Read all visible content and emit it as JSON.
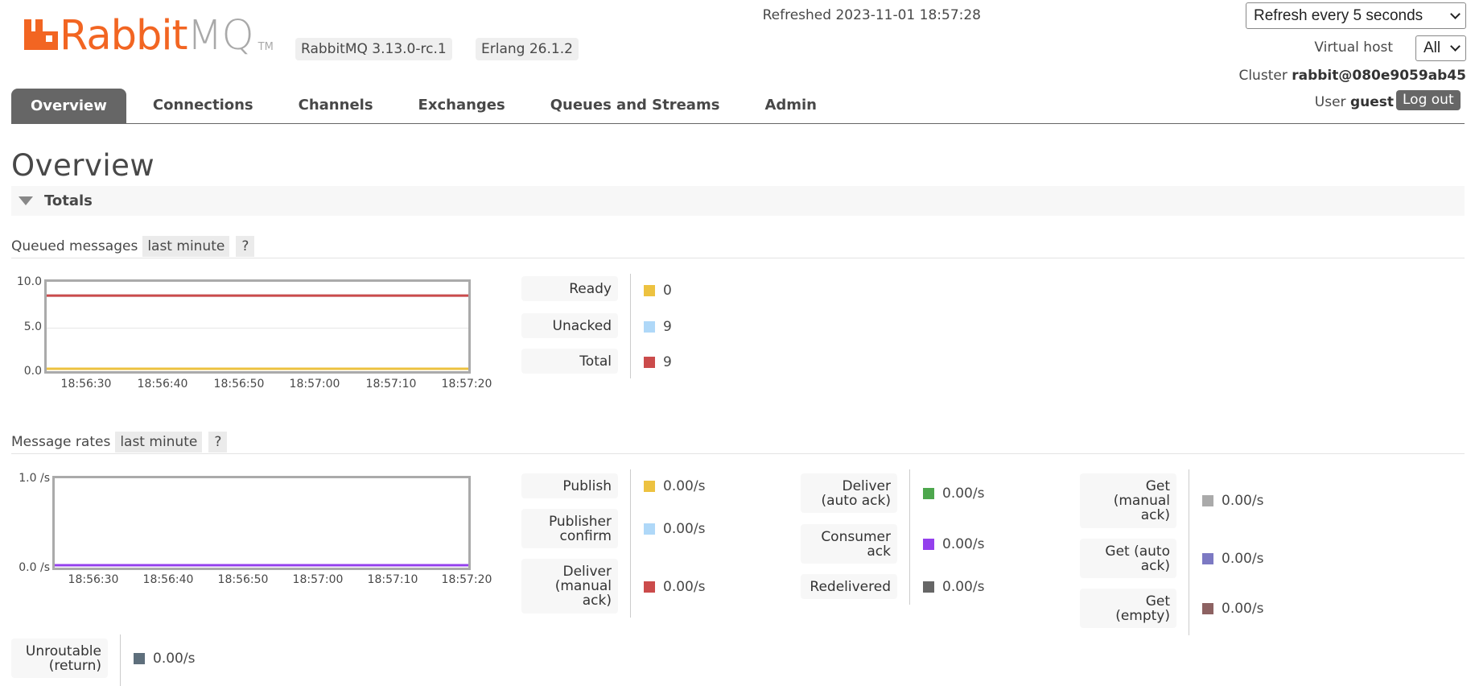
{
  "header": {
    "logo": {
      "part1": "Rabbit",
      "part2": "MQ",
      "tm": "TM"
    },
    "version": "RabbitMQ 3.13.0-rc.1",
    "erlang": "Erlang 26.1.2",
    "refreshed": "Refreshed 2023-11-01 18:57:28",
    "refresh_select": "Refresh every 5 seconds",
    "vhost_label": "Virtual host",
    "vhost_select": "All",
    "cluster_label": "Cluster",
    "cluster_name": "rabbit@080e9059ab45",
    "user_label": "User",
    "user_name": "guest",
    "logout": "Log out"
  },
  "tabs": [
    "Overview",
    "Connections",
    "Channels",
    "Exchanges",
    "Queues and Streams",
    "Admin"
  ],
  "page_title": "Overview",
  "totals_title": "Totals",
  "queued": {
    "label": "Queued messages",
    "range": "last minute",
    "help": "?",
    "chart_data": {
      "type": "line",
      "x": [
        "18:56:30",
        "18:56:40",
        "18:56:50",
        "18:57:00",
        "18:57:10",
        "18:57:20"
      ],
      "yticks": [
        "10.0",
        "5.0",
        "0.0"
      ],
      "ylim": [
        0,
        10
      ],
      "series": [
        {
          "name": "Ready",
          "color": "#edc240",
          "values": [
            0,
            0,
            0,
            0,
            0,
            0
          ]
        },
        {
          "name": "Unacked",
          "color": "#afd8f8",
          "values": [
            9,
            9,
            9,
            9,
            9,
            9
          ]
        },
        {
          "name": "Total",
          "color": "#cb4b4b",
          "values": [
            9,
            9,
            9,
            9,
            9,
            9
          ]
        }
      ]
    },
    "legend": [
      {
        "label": "Ready",
        "value": "0",
        "color": "#edc240"
      },
      {
        "label": "Unacked",
        "value": "9",
        "color": "#afd8f8"
      },
      {
        "label": "Total",
        "value": "9",
        "color": "#cb4b4b"
      }
    ]
  },
  "rates": {
    "label": "Message rates",
    "range": "last minute",
    "help": "?",
    "chart_data": {
      "type": "line",
      "x": [
        "18:56:30",
        "18:56:40",
        "18:56:50",
        "18:57:00",
        "18:57:10",
        "18:57:20"
      ],
      "yticks": [
        "1.0 /s",
        "0.0 /s"
      ],
      "ylim": [
        0,
        1
      ],
      "series": [
        {
          "name": "Publish",
          "color": "#edc240",
          "values": [
            0,
            0,
            0,
            0,
            0,
            0
          ]
        },
        {
          "name": "Get (auto ack)",
          "color": "#7c79c3",
          "values": [
            0,
            0,
            0,
            0,
            0,
            0
          ]
        },
        {
          "name": "Consumer ack",
          "color": "#9440ed",
          "values": [
            0,
            0,
            0,
            0,
            0,
            0
          ]
        }
      ]
    },
    "col1": [
      {
        "label": "Publish",
        "value": "0.00/s",
        "color": "#edc240"
      },
      {
        "label": "Publisher\nconfirm",
        "value": "0.00/s",
        "color": "#afd8f8"
      },
      {
        "label": "Deliver\n(manual\nack)",
        "value": "0.00/s",
        "color": "#cb4b4b"
      }
    ],
    "col2": [
      {
        "label": "Deliver\n(auto ack)",
        "value": "0.00/s",
        "color": "#4da74d"
      },
      {
        "label": "Consumer\nack",
        "value": "0.00/s",
        "color": "#9440ed"
      },
      {
        "label": "Redelivered",
        "value": "0.00/s",
        "color": "#666666"
      }
    ],
    "col3": [
      {
        "label": "Get\n(manual\nack)",
        "value": "0.00/s",
        "color": "#aaaaaa"
      },
      {
        "label": "Get (auto\nack)",
        "value": "0.00/s",
        "color": "#7c79c3"
      },
      {
        "label": "Get\n(empty)",
        "value": "0.00/s",
        "color": "#8d6262"
      }
    ],
    "unroutable": {
      "label": "Unroutable\n(return)",
      "value": "0.00/s",
      "color": "#5e6f7c"
    }
  }
}
